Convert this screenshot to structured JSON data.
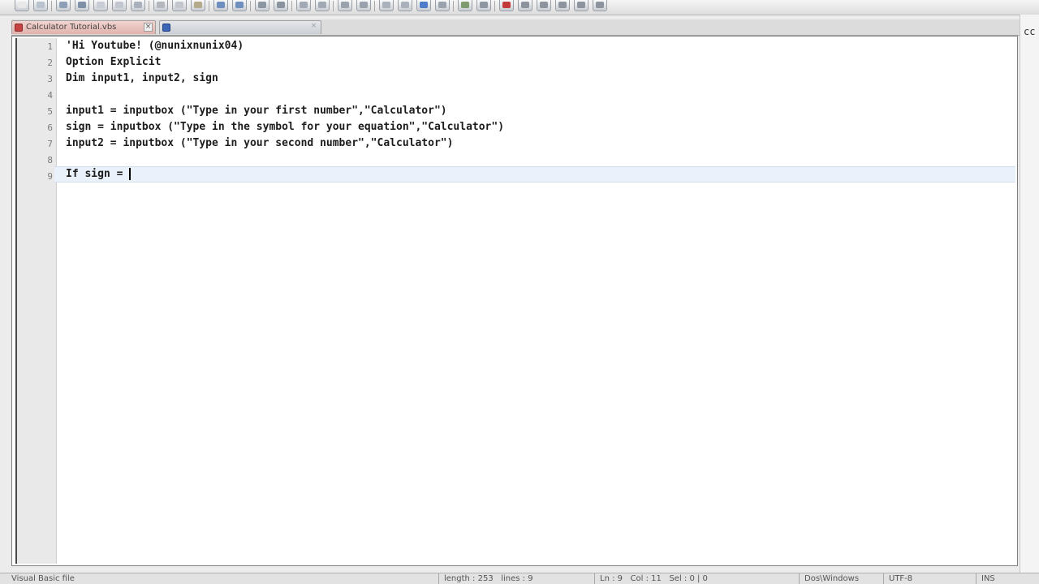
{
  "toolbar": {
    "buttons": [
      {
        "name": "new-file-icon",
        "color": "#e8e8e8"
      },
      {
        "name": "open-file-icon",
        "color": "#b9c3cf"
      },
      {
        "name": "save-icon",
        "color": "#8ea0b8"
      },
      {
        "name": "save-all-icon",
        "color": "#7e8fa7"
      },
      {
        "name": "close-icon",
        "color": "#c9ced6"
      },
      {
        "name": "close-all-icon",
        "color": "#c2c7cf"
      },
      {
        "name": "print-icon",
        "color": "#a9b1bc"
      },
      {
        "name": "cut-icon",
        "color": "#b4b8be"
      },
      {
        "name": "copy-icon",
        "color": "#c3c7cd"
      },
      {
        "name": "paste-icon",
        "color": "#b5a98c"
      },
      {
        "name": "undo-icon",
        "color": "#6f8fbf"
      },
      {
        "name": "redo-icon",
        "color": "#6f8fbf"
      },
      {
        "name": "find-icon",
        "color": "#8c96a3"
      },
      {
        "name": "replace-icon",
        "color": "#8a94a1"
      },
      {
        "name": "zoom-in-icon",
        "color": "#a1a9b4"
      },
      {
        "name": "zoom-out-icon",
        "color": "#a1a9b4"
      },
      {
        "name": "sync-vertical-icon",
        "color": "#9aa3ad"
      },
      {
        "name": "sync-horizontal-icon",
        "color": "#9aa3ad"
      },
      {
        "name": "word-wrap-icon",
        "color": "#aab1ba"
      },
      {
        "name": "show-all-chars-icon",
        "color": "#aab1ba"
      },
      {
        "name": "indent-guide-icon",
        "color": "#4f7cc9"
      },
      {
        "name": "user-language-icon",
        "color": "#9aa3ad"
      },
      {
        "name": "doc-map-icon",
        "color": "#7f9a6d"
      },
      {
        "name": "function-list-icon",
        "color": "#8f97a2"
      },
      {
        "name": "record-macro-icon",
        "color": "#c23a3a"
      },
      {
        "name": "stop-macro-icon",
        "color": "#8d949e"
      },
      {
        "name": "play-macro-icon",
        "color": "#8d949e"
      },
      {
        "name": "run-macro-multiple-icon",
        "color": "#8d949e"
      },
      {
        "name": "save-macro-icon",
        "color": "#8d949e"
      },
      {
        "name": "spellcheck-icon",
        "color": "#8d949e"
      }
    ]
  },
  "tabs": [
    {
      "label": "Calculator Tutorial.vbs",
      "active": true
    },
    {
      "label": "",
      "active": false
    }
  ],
  "right_edge_text": "cc",
  "editor": {
    "line_numbers": [
      "1",
      "2",
      "3",
      "4",
      "5",
      "6",
      "7",
      "8",
      "9"
    ],
    "lines": [
      "'Hi Youtube! (@nunixnunix04)",
      "Option Explicit",
      "Dim input1, input2, sign",
      "",
      "input1 = inputbox (\"Type in your first number\",\"Calculator\")",
      "sign = inputbox (\"Type in the symbol for your equation\",\"Calculator\")",
      "input2 = inputbox (\"Type in your second number\",\"Calculator\")",
      "",
      "If sign = "
    ],
    "current_line": 9
  },
  "status": {
    "file_type": "Visual Basic file",
    "length": "length : 253",
    "lines": "lines : 9",
    "ln": "Ln : 9",
    "col": "Col : 11",
    "sel": "Sel : 0 | 0",
    "eol": "Dos\\Windows",
    "encoding": "UTF-8",
    "mode": "INS"
  }
}
